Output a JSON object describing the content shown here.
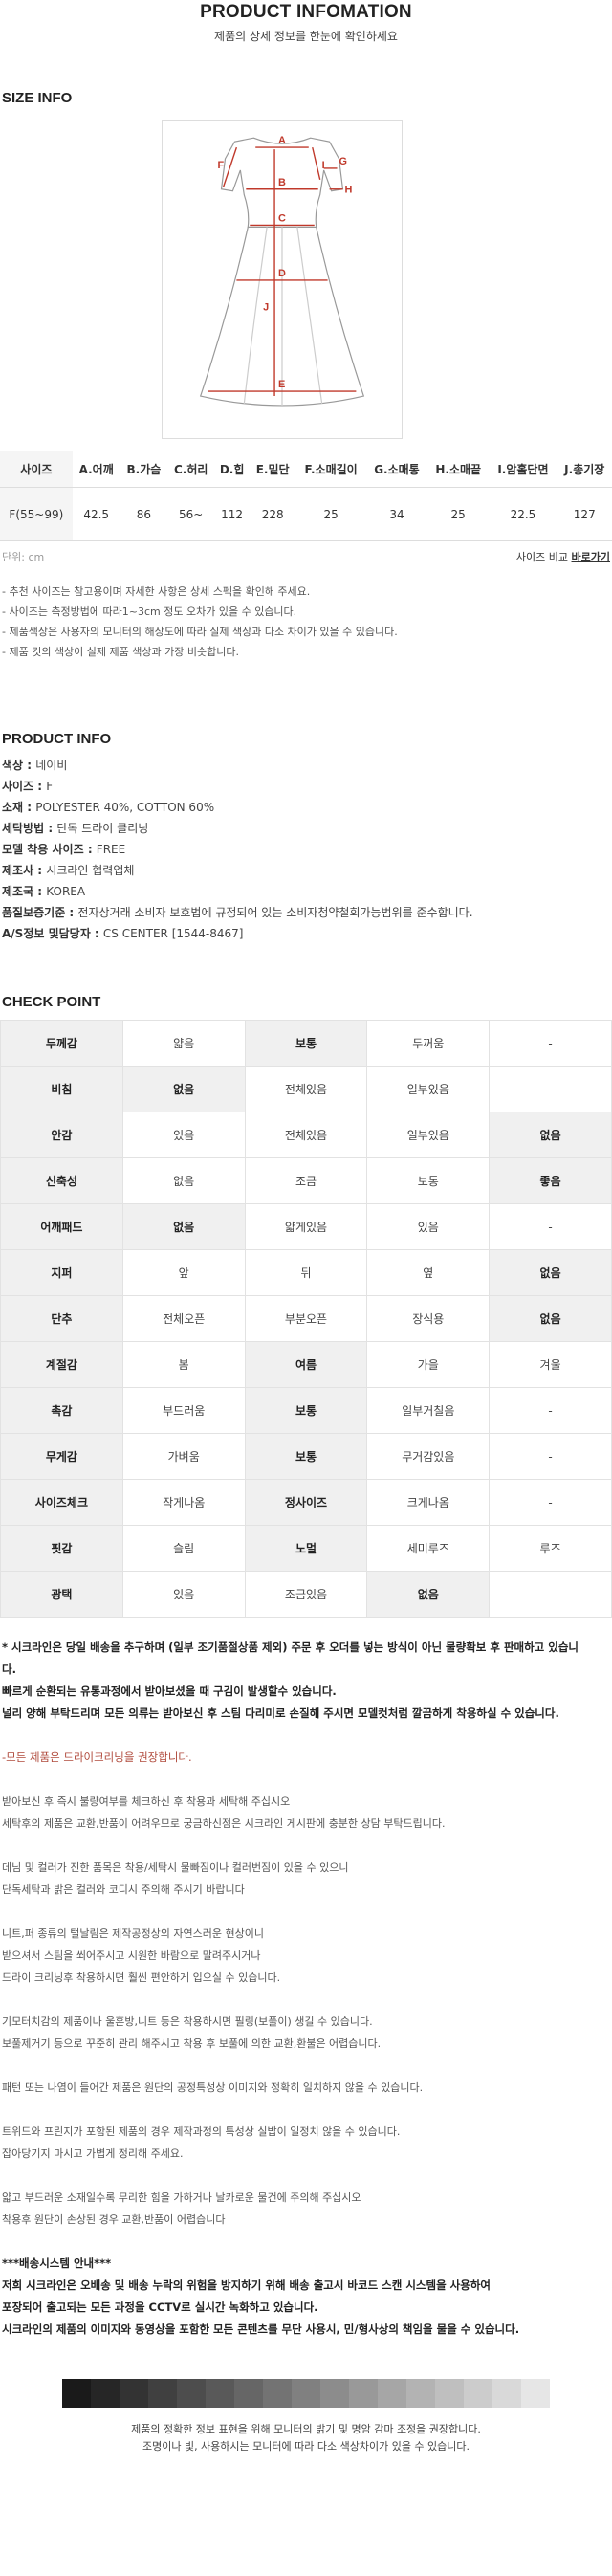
{
  "header": {
    "title": "PRODUCT INFOMATION",
    "subtitle": "제품의 상세 정보를 한눈에 확인하세요"
  },
  "size_info": {
    "heading": "SIZE INFO",
    "diagram_labels": [
      "A",
      "B",
      "C",
      "D",
      "E",
      "F",
      "G",
      "H",
      "I",
      "J"
    ],
    "columns": [
      "사이즈",
      "A.어깨",
      "B.가슴",
      "C.허리",
      "D.힙",
      "E.밑단",
      "F.소매길이",
      "G.소매통",
      "H.소매끝",
      "I.암홀단면",
      "J.총기장"
    ],
    "row": [
      "F(55~99)",
      "42.5",
      "86",
      "56~",
      "112",
      "228",
      "25",
      "34",
      "25",
      "22.5",
      "127"
    ],
    "unit": "단위: cm",
    "compare_text": "사이즈 비교 ",
    "compare_link": "바로가기",
    "notes": [
      "- 추천 사이즈는 참고용이며 자세한 사항은 상세 스펙을 확인해 주세요.",
      "- 사이즈는 측정방법에 따라1~3cm 정도 오차가 있을 수 있습니다.",
      "- 제품색상은 사용자의 모니터의 해상도에 따라 실제 색상과 다소 차이가 있을 수 있습니다.",
      "- 제품 컷의 색상이 실제 제품 색상과 가장 비슷합니다."
    ]
  },
  "product_info": {
    "heading": "PRODUCT INFO",
    "items": [
      {
        "label": "색상 : ",
        "value": "네이비"
      },
      {
        "label": "사이즈 : ",
        "value": "F"
      },
      {
        "label": "소재 : ",
        "value": "POLYESTER 40%, COTTON 60%"
      },
      {
        "label": "세탁방법 : ",
        "value": "단독 드라이 클리닝"
      },
      {
        "label": "모델 착용 사이즈 : ",
        "value": "FREE"
      },
      {
        "label": "제조사 : ",
        "value": "시크라인 협력업체"
      },
      {
        "label": "제조국 : ",
        "value": "KOREA"
      },
      {
        "label": "품질보증기준 : ",
        "value": "전자상거래 소비자 보호법에 규정되어 있는 소비자청약철회가능범위를 준수합니다."
      },
      {
        "label": "A/S정보 및담당자 : ",
        "value": "CS CENTER [1544-8467]"
      }
    ]
  },
  "check_point": {
    "heading": "CHECK POINT",
    "rows": [
      {
        "label": "두께감",
        "options": [
          "얇음",
          "보통",
          "두꺼움",
          "-"
        ],
        "selected": 1
      },
      {
        "label": "비침",
        "options": [
          "없음",
          "전체있음",
          "일부있음",
          "-"
        ],
        "selected": 0
      },
      {
        "label": "안감",
        "options": [
          "있음",
          "전체있음",
          "일부있음",
          "없음"
        ],
        "selected": 3
      },
      {
        "label": "신축성",
        "options": [
          "없음",
          "조금",
          "보통",
          "좋음"
        ],
        "selected": 3
      },
      {
        "label": "어깨패드",
        "options": [
          "없음",
          "얇게있음",
          "있음",
          "-"
        ],
        "selected": 0
      },
      {
        "label": "지퍼",
        "options": [
          "앞",
          "뒤",
          "옆",
          "없음"
        ],
        "selected": 3
      },
      {
        "label": "단추",
        "options": [
          "전체오픈",
          "부분오픈",
          "장식용",
          "없음"
        ],
        "selected": 3
      },
      {
        "label": "계절감",
        "options": [
          "봄",
          "여름",
          "가을",
          "겨울"
        ],
        "selected": 1
      },
      {
        "label": "촉감",
        "options": [
          "부드러움",
          "보통",
          "일부거칠음",
          "-"
        ],
        "selected": 1
      },
      {
        "label": "무게감",
        "options": [
          "가벼움",
          "보통",
          "무거감있음",
          "-"
        ],
        "selected": 1
      },
      {
        "label": "사이즈체크",
        "options": [
          "작게나옴",
          "정사이즈",
          "크게나옴",
          "-"
        ],
        "selected": 1
      },
      {
        "label": "핏감",
        "options": [
          "슬림",
          "노멀",
          "세미루즈",
          "루즈"
        ],
        "selected": 1
      },
      {
        "label": "광택",
        "options": [
          "있음",
          "조금있음",
          "없음",
          ""
        ],
        "selected": 2
      }
    ]
  },
  "care": {
    "bold_lines": [
      "* 시크라인은 당일 배송을 추구하며 (일부 조기품절상품 제외) 주문 후 오더를 넣는 방식이 아닌 물량확보 후 판매하고 있습니",
      "다.",
      "빠르게 순환되는 유통과정에서 받아보셨을 때 구김이 발생할수 있습니다.",
      "널리 양해 부탁드리며 모든 의류는 받아보신 후 스팀 다리미로 손질해 주시면 모델컷처럼 깔끔하게 착용하실 수 있습니다."
    ],
    "warning": "-모든 제품은 드라이크리닝을 권장합니다.",
    "paragraphs": [
      [
        "받아보신 후 즉시 불량여부를 체크하신 후 착용과 세탁해 주십시오",
        "세탁후의 제품은 교환,반품이 어려우므로 궁금하신점은 시크라인 게시판에 충분한 상담 부탁드립니다."
      ],
      [
        "데님 및 컬러가 진한 품목은 착용/세탁시 물빠짐이나 컬러번짐이 있을 수 있으니",
        "단독세탁과 밝은 컬러와 코디시 주의해 주시기 바랍니다"
      ],
      [
        "니트,퍼 종류의 털날림은 제작공정상의 자연스러운 현상이니",
        "받으셔서 스팀을 쐬어주시고 시원한 바람으로 말려주시거나",
        "드라이 크리닝후 착용하시면 훨씬 편안하게 입으실 수 있습니다."
      ],
      [
        "기모터치감의 제품이나 울혼방,니트 등은 착용하시면 필링(보풀이) 생길 수 있습니다.",
        "보풀제거기 등으로 꾸준히 관리 해주시고 착용 후 보풀에 의한 교환,환불은 어렵습니다."
      ],
      [
        "패턴 또는 나염이 들어간 제품은 원단의 공정특성상 이미지와 정확히 일치하지 않을 수 있습니다."
      ],
      [
        "트위드와 프린지가 포함된 제품의 경우 제작과정의 특성상 실밥이 일정치 않을 수 있습니다.",
        "잡아당기지 마시고 가볍게 정리해 주세요."
      ],
      [
        "얇고 부드러운 소재일수록 무리한 힘을 가하거나 날카로운 물건에 주의해 주십시오",
        "착용후 원단이 손상된 경우 교환,반품이 어렵습니다"
      ]
    ],
    "notice_title": "***배송시스템 안내***",
    "notice_lines": [
      "저희 시크라인은 오배송 및 배송 누락의 위험을 방지하기 위해 배송 출고시 바코드 스캔 시스템을 사용하여",
      "포장되어 출고되는 모든 과정을 CCTV로 실시간 녹화하고 있습니다.",
      "시크라인의 제품의 이미지와 동영상을 포함한 모든 콘텐츠를 무단 사용시, 민/형사상의 책임을 물을 수 있습니다."
    ]
  },
  "footer": {
    "grayscale": [
      "#1a1a1a",
      "#262626",
      "#333333",
      "#404040",
      "#4d4d4d",
      "#595959",
      "#666666",
      "#737373",
      "#808080",
      "#8c8c8c",
      "#999999",
      "#a6a6a6",
      "#b3b3b3",
      "#bfbfbf",
      "#cccccc",
      "#d9d9d9",
      "#e6e6e6"
    ],
    "lines": [
      "제품의 정확한 정보 표현을 위해 모니터의 밝기 및 명암 감마 조정을 권장합니다.",
      "조명이나 빛, 사용하시는 모니터에 따라 다소 색상차이가 있을 수 있습니다."
    ]
  },
  "colors": {
    "accent_line": "#c0392b",
    "warning_text": "#b04a3c",
    "cell_highlight": "#f0f0f0"
  }
}
